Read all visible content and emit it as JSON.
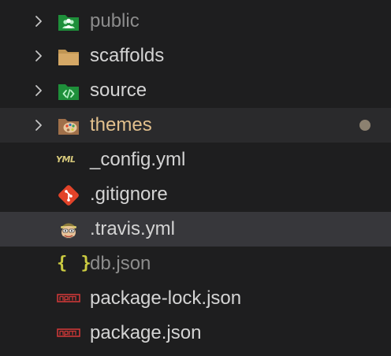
{
  "explorer": {
    "items": [
      {
        "label": "public",
        "icon": "folder-public-icon",
        "expandable": true,
        "style": "dim"
      },
      {
        "label": "scaffolds",
        "icon": "folder-icon",
        "expandable": true,
        "style": "normal"
      },
      {
        "label": "source",
        "icon": "folder-source-icon",
        "expandable": true,
        "style": "normal"
      },
      {
        "label": "themes",
        "icon": "folder-theme-icon",
        "expandable": true,
        "style": "modified",
        "badge": "modified-dot"
      },
      {
        "label": "_config.yml",
        "icon": "yaml-icon",
        "icon_text": "YML",
        "expandable": false,
        "style": "normal"
      },
      {
        "label": ".gitignore",
        "icon": "git-icon",
        "expandable": false,
        "style": "normal"
      },
      {
        "label": ".travis.yml",
        "icon": "travis-icon",
        "expandable": false,
        "style": "normal",
        "selected": true
      },
      {
        "label": "db.json",
        "icon": "json-icon",
        "icon_text": "{ }",
        "expandable": false,
        "style": "dim"
      },
      {
        "label": "package-lock.json",
        "icon": "npm-icon",
        "expandable": false,
        "style": "normal"
      },
      {
        "label": "package.json",
        "icon": "npm-icon",
        "expandable": false,
        "style": "normal"
      }
    ]
  },
  "colors": {
    "background": "#1e1e1f",
    "hover_row": "#2a2a2c",
    "selected_row": "#37373b",
    "text": "#d4d4d4",
    "dim_text": "#8c8c8c",
    "modified_text": "#e2c08d",
    "folder_brown": "#c09553",
    "folder_green": "#1e8f3a",
    "git_red": "#e24329",
    "npm_red": "#cb3837",
    "json_yellow": "#cbcb41"
  }
}
